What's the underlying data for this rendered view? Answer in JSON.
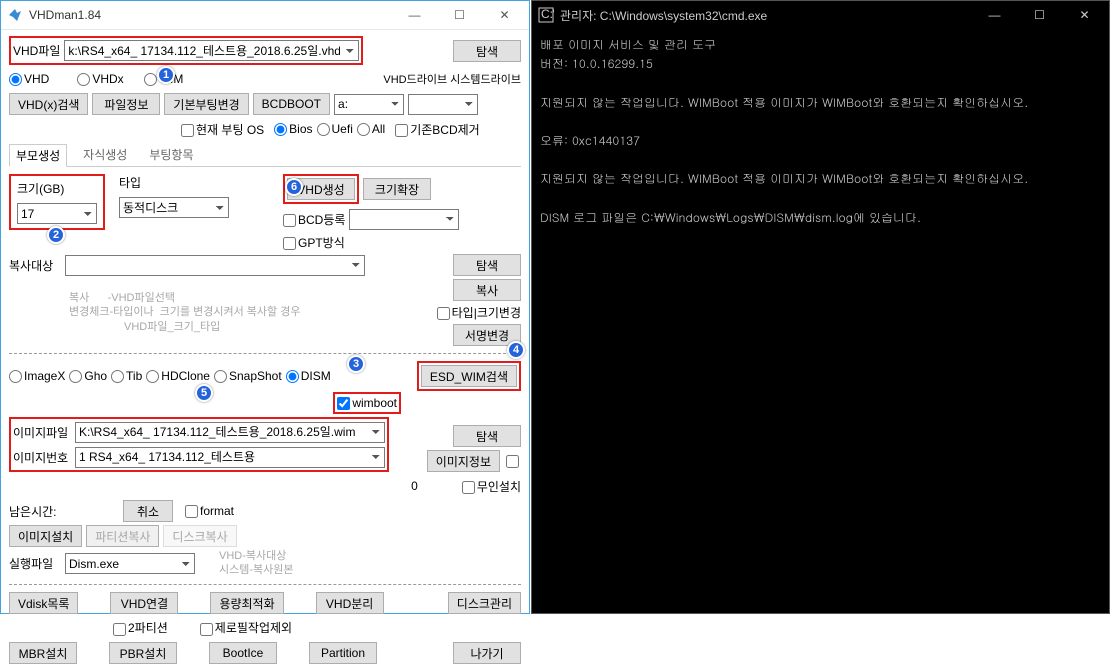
{
  "app": {
    "title": "VHDman1.84",
    "buttons": {
      "min": "—",
      "max": "☐",
      "close": "✕"
    },
    "vhdfile_lbl": "VHD파일",
    "vhdfile_val": "k:\\RS4_x64_ 17134.112_테스트용_2018.6.25일.vhd",
    "browse": "탐색",
    "radios1": {
      "vhd": "VHD",
      "vhdx": "VHDx",
      "wim": "WIM"
    },
    "drives_lbl": "VHD드라이브 시스템드라이브",
    "btnrow": {
      "vhdsearch": "VHD(x)검색",
      "fileinfo": "파일정보",
      "bootchange": "기본부팅변경",
      "bcdboot": "BCDBOOT",
      "drive_sel": "a:"
    },
    "cb_currentos": "현재 부팅 OS",
    "radios2": {
      "bios": "Bios",
      "uefi": "Uefi",
      "all": "All"
    },
    "cb_bcdremove": "기존BCD제거",
    "tabs": {
      "parent": "부모생성",
      "child": "자식생성",
      "bootitem": "부팅항목"
    },
    "size_lbl": "크기(GB)",
    "size_val": "17",
    "type_lbl": "타입",
    "type_val": "동적디스크",
    "btn_vhdcreate": "VHD생성",
    "btn_sizeexpand": "크기확장",
    "cb_bcdreg": "BCD등록",
    "cb_gpt": "GPT방식",
    "copytarget_lbl": "복사대상",
    "copytarget_val": "",
    "copy_hint1": "복사      -VHD파일선택\n변경체크-타입이나  크기를 변경시켜서 복사할 경우\n                  VHD파일_크기_타입",
    "btn_copy": "복사",
    "cb_typesize": "타입|크기변경",
    "btn_rename": "서명변경",
    "radios3": {
      "imagex": "ImageX",
      "gho": "Gho",
      "tib": "Tib",
      "hdclone": "HDClone",
      "snapshot": "SnapShot",
      "dism": "DISM"
    },
    "cb_wimboot": "wimboot",
    "btn_esdwim": "ESD_WIM검색",
    "imgfile_lbl": "이미지파일",
    "imgfile_val": "K:\\RS4_x64_ 17134.112_테스트용_2018.6.25일.wim",
    "imgnum_lbl": "이미지번호",
    "imgnum_val": "1 RS4_x64_ 17134.112_테스트용",
    "btn_imginfo": "이미지정보",
    "cb_unattend": "무인설치",
    "zero": "0",
    "remain_lbl": "남은시간:",
    "btn_cancel": "취소",
    "cb_format": "format",
    "btn_imginstall": "이미지설치",
    "btn_partcopy": "파티션복사",
    "btn_diskcopy": "디스크복사",
    "exec_lbl": "실행파일",
    "exec_val": "Dism.exe",
    "exec_hint": "VHD-복사대상\n시스템-복사원본",
    "btn_vdisklist": "Vdisk목록",
    "btn_vhdconn": "VHD연결",
    "btn_capopt": "용량최적화",
    "btn_vhdsep": "VHD분리",
    "btn_diskmgmt": "디스크관리",
    "cb_2part": "2파티션",
    "cb_zerofill": "제로필작업제외",
    "btn_mbr": "MBR설치",
    "btn_pbr": "PBR설치",
    "btn_bootice": "BootIce",
    "btn_partition": "Partition",
    "btn_exit": "나가기"
  },
  "cmd": {
    "title": "관리자: C:\\Windows\\system32\\cmd.exe",
    "body": "배포 이미지 서비스 및 관리 도구\n버전: 10.0.16299.15\n\n지원되지 않는 작업입니다. WIMBoot 적용 이미지가 WIMBoot와 호환되는지 확인하십시오.\n\n오류: 0xc1440137\n\n지원되지 않는 작업입니다. WIMBoot 적용 이미지가 WIMBoot와 호환되는지 확인하십시오.\n\nDISM 로그 파일은 C:\\Windows\\Logs\\DISM\\dism.log에 있습니다."
  }
}
